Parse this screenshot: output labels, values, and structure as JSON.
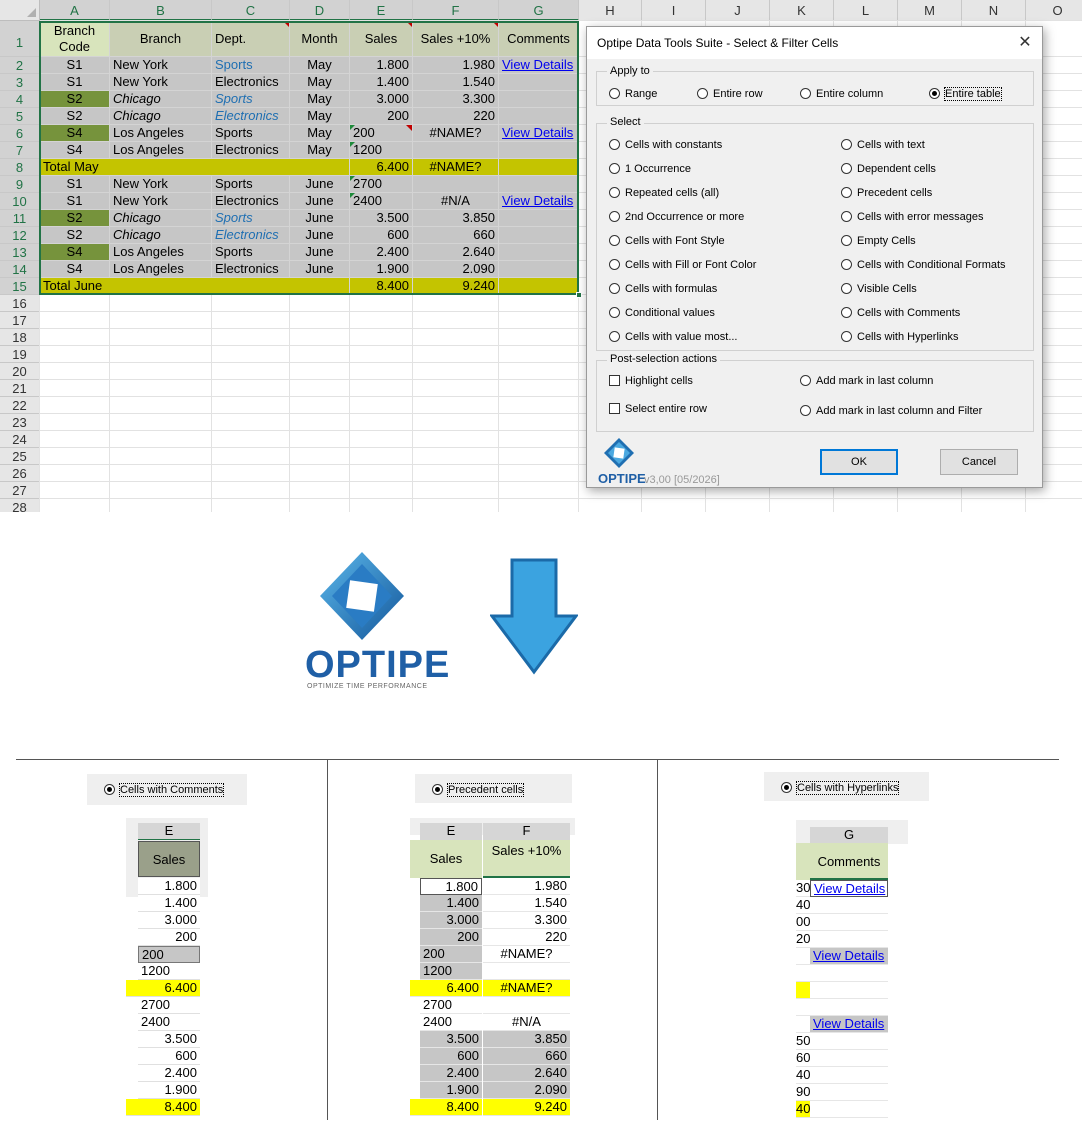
{
  "sheet": {
    "col_headers": [
      "A",
      "B",
      "C",
      "D",
      "E",
      "F",
      "G",
      "H",
      "I",
      "J",
      "K",
      "L",
      "M",
      "N",
      "O"
    ],
    "row_numbers": [
      "1",
      "2",
      "3",
      "4",
      "5",
      "6",
      "7",
      "8",
      "9",
      "10",
      "11",
      "12",
      "13",
      "14",
      "15",
      "16",
      "17",
      "18",
      "19",
      "20",
      "21",
      "22",
      "23",
      "24",
      "25",
      "26",
      "27",
      "28"
    ],
    "header_row": {
      "a": "Branch Code",
      "b": "Branch",
      "c": "Dept.",
      "d": "Month",
      "e": "Sales",
      "f": "Sales +10%",
      "g": "Comments"
    },
    "rows": [
      {
        "a": "S1",
        "b": "New York",
        "c": "Sports",
        "d": "May",
        "e": "1.800",
        "f": "1.980",
        "g": "View Details"
      },
      {
        "a": "S1",
        "b": "New York",
        "c": "Electronics",
        "d": "May",
        "e": "1.400",
        "f": "1.540",
        "g": ""
      },
      {
        "a": "S2",
        "b": "Chicago",
        "c": "Sports",
        "d": "May",
        "e": "3.000",
        "f": "3.300",
        "g": ""
      },
      {
        "a": "S2",
        "b": "Chicago",
        "c": "Electronics",
        "d": "May",
        "e": "200",
        "f": "220",
        "g": ""
      },
      {
        "a": "S4",
        "b": "Los Angeles",
        "c": "Sports",
        "d": "May",
        "e": "200",
        "f": "#NAME?",
        "g": "View Details"
      },
      {
        "a": "S4",
        "b": "Los Angeles",
        "c": "Electronics",
        "d": "May",
        "e": "1200",
        "f": "",
        "g": ""
      },
      {
        "a": "Total May",
        "b": "",
        "c": "",
        "d": "",
        "e": "6.400",
        "f": "#NAME?",
        "g": ""
      },
      {
        "a": "S1",
        "b": "New York",
        "c": "Sports",
        "d": "June",
        "e": "2700",
        "f": "",
        "g": ""
      },
      {
        "a": "S1",
        "b": "New York",
        "c": "Electronics",
        "d": "June",
        "e": "2400",
        "f": "#N/A",
        "g": "View Details"
      },
      {
        "a": "S2",
        "b": "Chicago",
        "c": "Sports",
        "d": "June",
        "e": "3.500",
        "f": "3.850",
        "g": ""
      },
      {
        "a": "S2",
        "b": "Chicago",
        "c": "Electronics",
        "d": "June",
        "e": "600",
        "f": "660",
        "g": ""
      },
      {
        "a": "S4",
        "b": "Los Angeles",
        "c": "Sports",
        "d": "June",
        "e": "2.400",
        "f": "2.640",
        "g": ""
      },
      {
        "a": "S4",
        "b": "Los Angeles",
        "c": "Electronics",
        "d": "June",
        "e": "1.900",
        "f": "2.090",
        "g": ""
      },
      {
        "a": "Total June",
        "b": "",
        "c": "",
        "d": "",
        "e": "8.400",
        "f": "9.240",
        "g": ""
      }
    ]
  },
  "dialog": {
    "title": "Optipe Data Tools Suite - Select & Filter Cells",
    "close_glyph": "✕",
    "apply_to": {
      "label": "Apply to",
      "options": [
        "Range",
        "Entire row",
        "Entire column",
        "Entire table"
      ],
      "selected": "Entire table"
    },
    "select": {
      "label": "Select",
      "left": [
        "Cells with constants",
        "1 Occurrence",
        "Repeated cells (all)",
        "2nd Occurrence or more",
        "Cells with Font Style",
        "Cells with Fill or Font Color",
        "Cells with formulas",
        "Conditional values",
        "Cells with value most..."
      ],
      "right": [
        "Cells with text",
        "Dependent cells",
        "Precedent cells",
        "Cells with error messages",
        "Empty Cells",
        "Cells with Conditional Formats",
        "Visible Cells",
        "Cells with Comments",
        "Cells with Hyperlinks"
      ]
    },
    "post": {
      "label": "Post-selection actions",
      "highlight": "Highlight cells",
      "entire_row": "Select entire row",
      "mark_last": "Add mark in last column",
      "mark_filter": "Add mark in last column and Filter"
    },
    "ok": "OK",
    "cancel": "Cancel",
    "brand": "OPTIPE",
    "version": "v3,00 [05/2026]"
  },
  "logo": {
    "brand": "OPTIPE",
    "tagline": "OPTIMIZE TIME PERFORMANCE"
  },
  "panels": {
    "comments": {
      "option": "Cells with Comments",
      "col": "E",
      "header": "Sales",
      "values": [
        "1.800",
        "1.400",
        "3.000",
        "200",
        "200",
        "1200",
        "6.400",
        "2700",
        "2400",
        "3.500",
        "600",
        "2.400",
        "1.900",
        "8.400"
      ]
    },
    "precedent": {
      "option": "Precedent cells",
      "col_e": "E",
      "col_f": "F",
      "header_e": "Sales",
      "header_f": "Sales +10%",
      "e": [
        "1.800",
        "1.400",
        "3.000",
        "200",
        "200",
        "1200",
        "6.400",
        "2700",
        "2400",
        "3.500",
        "600",
        "2.400",
        "1.900",
        "8.400"
      ],
      "f": [
        "1.980",
        "1.540",
        "3.300",
        "220",
        "#NAME?",
        "",
        "#NAME?",
        "",
        "#N/A",
        "3.850",
        "660",
        "2.640",
        "2.090",
        "9.240"
      ]
    },
    "hyperlinks": {
      "option": "Cells with Hyperlinks",
      "col": "G",
      "header": "Comments",
      "link": "View Details",
      "edge": [
        "30",
        "40",
        "00",
        "20",
        "",
        "",
        "",
        "",
        "",
        "50",
        "60",
        "40",
        "90",
        "40"
      ]
    }
  },
  "colors": {
    "header_green": "#d8e4bc",
    "sel_gray": "#c6c6c6",
    "dark_green": "#76933c",
    "total_yellow": "#c4c400",
    "highlight_yellow": "#ffff00",
    "accent_blue": "#0078d7"
  }
}
